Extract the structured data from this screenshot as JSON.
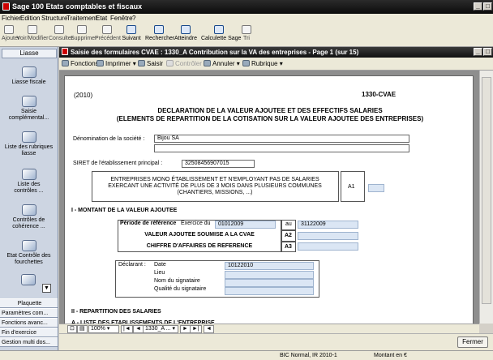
{
  "app": {
    "title": "Sage 100 Etats comptables et fiscaux"
  },
  "menu": [
    "Fichier",
    "Edition",
    "Structure",
    "Traitement",
    "Etat",
    "Fenêtre",
    "?"
  ],
  "toolbar": [
    {
      "label": "Ajouter",
      "icon": "add-icon",
      "enabled": false
    },
    {
      "label": "Voir/Modifier",
      "icon": "edit-icon",
      "enabled": false
    },
    {
      "label": "Consulter",
      "icon": "view-icon",
      "enabled": false
    },
    {
      "label": "Supprimer",
      "icon": "trash-icon",
      "enabled": false
    },
    {
      "label": "Précédent",
      "icon": "arrow-left-icon",
      "enabled": false
    },
    {
      "label": "Suivant",
      "icon": "arrow-right-icon",
      "enabled": true
    },
    {
      "label": "Rechercher",
      "icon": "search-icon",
      "enabled": true
    },
    {
      "label": "Atteindre",
      "icon": "goto-icon",
      "enabled": true
    },
    {
      "label": "Calculette Sage",
      "icon": "calculator-icon",
      "enabled": true
    },
    {
      "label": "Tri",
      "icon": "sort-icon",
      "enabled": false
    }
  ],
  "sidebar": {
    "header": "Liasse",
    "items": [
      {
        "label": "Liasse fiscale",
        "icon": "book-icon"
      },
      {
        "label": "Saisie complémental...",
        "icon": "pencil-icon"
      },
      {
        "label": "Liste des rubriques liasse",
        "icon": "list-icon"
      },
      {
        "label": "Liste des contrôles ...",
        "icon": "check-list-icon"
      },
      {
        "label": "Contrôles de cohérence ...",
        "icon": "check-icon"
      },
      {
        "label": "Etat Contrôle des fourchettes",
        "icon": "fork-icon"
      }
    ],
    "bottom_buttons": [
      "Plaquette",
      "Paramètres com...",
      "Fonctions avanc...",
      "Fin d'exercice",
      "Gestion multi dos..."
    ]
  },
  "document": {
    "title": "Saisie des formulaires CVAE : 1330_A  Contribution sur la VA des entreprises - Page 1 (sur 15)",
    "toolbar": {
      "fonctions": "Fonctions",
      "imprimer": "Imprimer",
      "saisir": "Saisir",
      "controler": "Contrôler",
      "annuler": "Annuler",
      "rubrique": "Rubrique"
    }
  },
  "form": {
    "year": "(2010)",
    "code": "1330-CVAE",
    "title1": "DECLARATION DE LA VALEUR AJOUTEE ET DES EFFECTIFS SALARIES",
    "title2": "(ELEMENTS DE REPARTITION DE LA COTISATION SUR LA VALEUR AJOUTEE DES ENTREPRISES)",
    "denomination_label": "Dénomination de la société :",
    "denomination_value": "Bijou SA",
    "siret_label": "SIRET de l'établissement principal :",
    "siret_value": "32508456907015",
    "notice": "ENTREPRISES MONO ÉTABLISSEMENT ET N'EMPLOYANT PAS DE SALARIES EXERCANT UNE ACTIVITÉ DE PLUS DE 3 MOIS DANS PLUSIEURS COMMUNES (CHANTIERS, MISSIONS, ...)",
    "a1": "A1",
    "section1": "I - MONTANT DE LA VALEUR AJOUTEE",
    "periode_label": "Période de référence",
    "exercice_label": "Exercice du",
    "date_start": "01012009",
    "au_label": "au",
    "date_end": "31122009",
    "va_label": "VALEUR AJOUTEE SOUMISE A LA CVAE",
    "a2": "A2",
    "ca_label": "CHIFFRE D'AFFAIRES DE REFERENCE",
    "a3": "A3",
    "declarant_label": "Déclarant :",
    "date_label": "Date",
    "date_value": "10122010",
    "lieu_label": "Lieu",
    "nom_label": "Nom du signataire",
    "qualite_label": "Qualité du signataire",
    "section2": "II - REPARTITION DES SALARIES",
    "section2a": "A - LISTE DES ETABLISSEMENTS DE L'ENTREPRISE"
  },
  "navigation": {
    "zoom": "100%",
    "page": "1330_A ..."
  },
  "buttons": {
    "fermer": "Fermer"
  },
  "status": {
    "left": "BIC Normal, IR 2010-1",
    "right": "Montant en €"
  }
}
